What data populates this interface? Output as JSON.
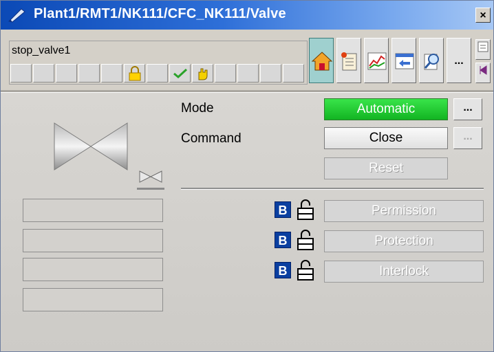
{
  "window": {
    "title": "Plant1/RMT1/NK111/CFC_NK111/Valve",
    "close_label": "×"
  },
  "header": {
    "tag_name": "stop_valve1",
    "status_icons": [
      "",
      "",
      "",
      "",
      "",
      "lock-icon",
      "",
      "check-icon",
      "hand-icon",
      "",
      "",
      "",
      ""
    ],
    "toolbar": [
      {
        "name": "home-view-button",
        "icon": "home-icon",
        "active": true
      },
      {
        "name": "messages-view-button",
        "icon": "message-list-icon",
        "active": false
      },
      {
        "name": "trend-view-button",
        "icon": "trend-icon",
        "active": false
      },
      {
        "name": "faceplate-view-button",
        "icon": "faceplate-icon",
        "active": false
      },
      {
        "name": "loop-view-button",
        "icon": "magnifier-icon",
        "active": false
      },
      {
        "name": "more-views-button",
        "icon": "dots",
        "label": "...",
        "active": false
      }
    ]
  },
  "body": {
    "mode_label": "Mode",
    "mode_value": "Automatic",
    "command_label": "Command",
    "command_value": "Close",
    "reset_label": "Reset",
    "dots_label": "...",
    "permission_label": "Permission",
    "protection_label": "Protection",
    "interlock_label": "Interlock",
    "bypass_badge": "B"
  },
  "colors": {
    "automatic_green": "#12b422",
    "title_blue": "#0b49b6",
    "bypass_blue": "#0a3fa0"
  }
}
